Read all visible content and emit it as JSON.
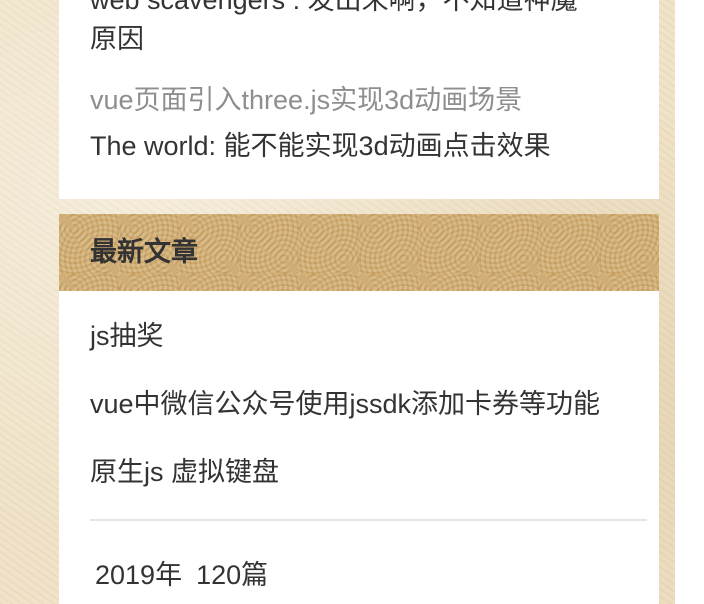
{
  "recent_comments": {
    "truncated_line1": "web scavengers : 发出来啊，不知道神魔",
    "truncated_line2": "原因",
    "item_link": "vue页面引入three.js实现3d动画场景",
    "item_text": "The world: 能不能实现3d动画点击效果"
  },
  "latest_posts": {
    "title": "最新文章",
    "items": [
      {
        "label": "js抽奖"
      },
      {
        "label": "vue中微信公众号使用jssdk添加卡券等功能"
      },
      {
        "label": "原生js 虚拟键盘"
      }
    ]
  },
  "archive": {
    "year": "2019年",
    "count": "120篇"
  },
  "colors": {
    "text": "#333333",
    "muted_link": "#8e8e8e",
    "card_bg": "#ffffff",
    "page_bg": "#efe2c6"
  }
}
